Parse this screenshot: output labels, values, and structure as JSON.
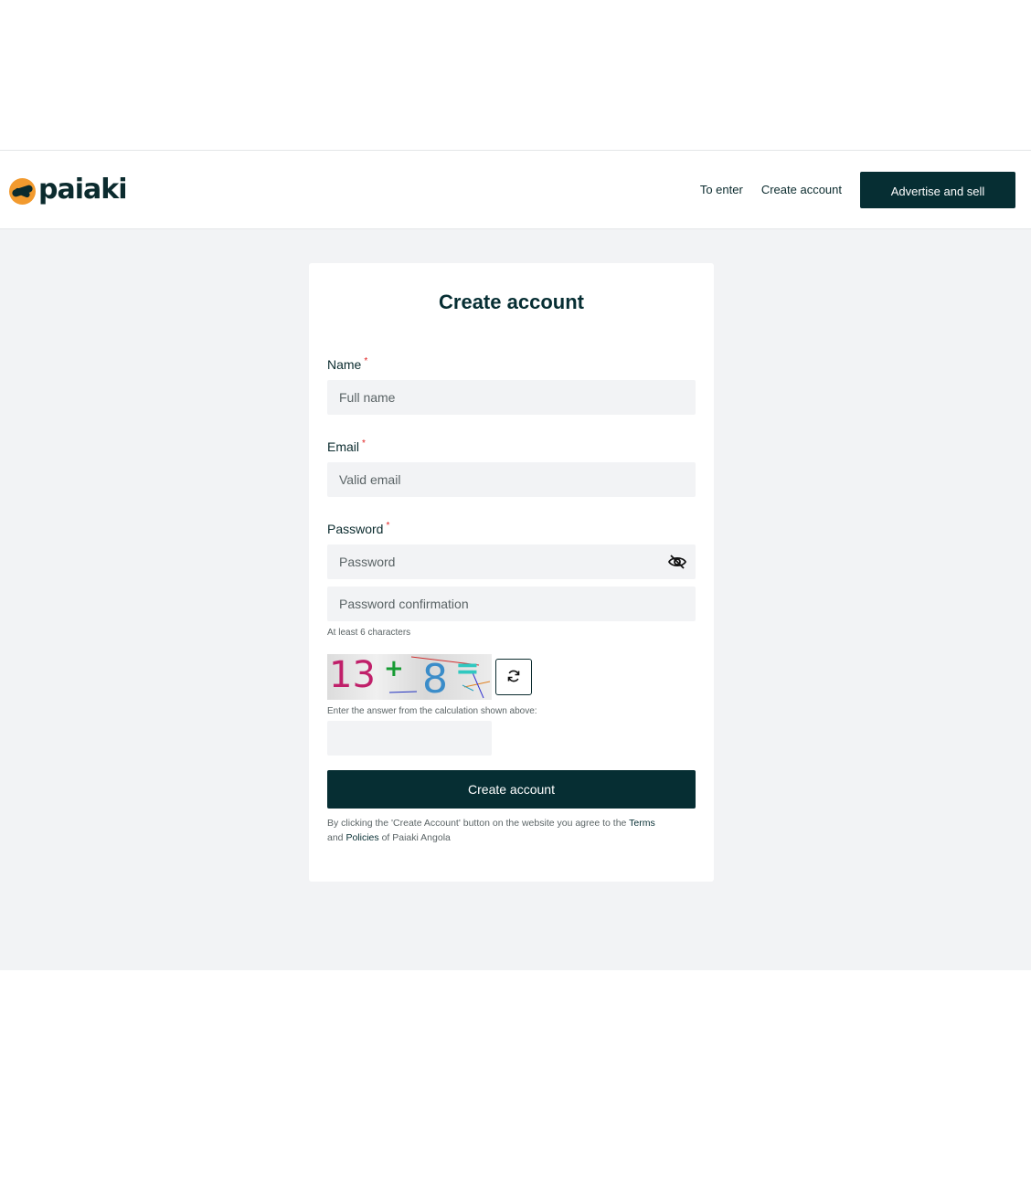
{
  "header": {
    "logo_text": "paiaki",
    "nav": {
      "login_label": "To enter",
      "create_account_label": "Create account",
      "cta_label": "Advertise and sell"
    }
  },
  "form": {
    "title": "Create account",
    "name": {
      "label": "Name",
      "required_mark": "*",
      "placeholder": "Full name"
    },
    "email": {
      "label": "Email",
      "required_mark": "*",
      "placeholder": "Valid email"
    },
    "password": {
      "label": "Password",
      "required_mark": "*",
      "placeholder": "Password",
      "confirmation_placeholder": "Password confirmation",
      "hint": "At least 6 characters"
    },
    "captcha": {
      "expression": [
        "13",
        "+",
        "8",
        "="
      ],
      "prompt": "Enter the answer from the calculation shown above:",
      "answer_value": ""
    },
    "submit_label": "Create account",
    "terms": {
      "prefix": "By clicking the 'Create Account' button on the website you agree to the",
      "terms_link": "Terms",
      "middle": "and",
      "policies_link": "Policies",
      "suffix": "of Paiaki Angola"
    }
  },
  "colors": {
    "brand_dark": "#062e33",
    "brand_orange": "#f29a2e",
    "required": "#e02020",
    "page_bg": "#f2f3f5"
  },
  "icons": {
    "password_toggle": "eye-off-icon",
    "captcha_refresh": "refresh-icon",
    "logo": "handshake-logo-icon"
  }
}
